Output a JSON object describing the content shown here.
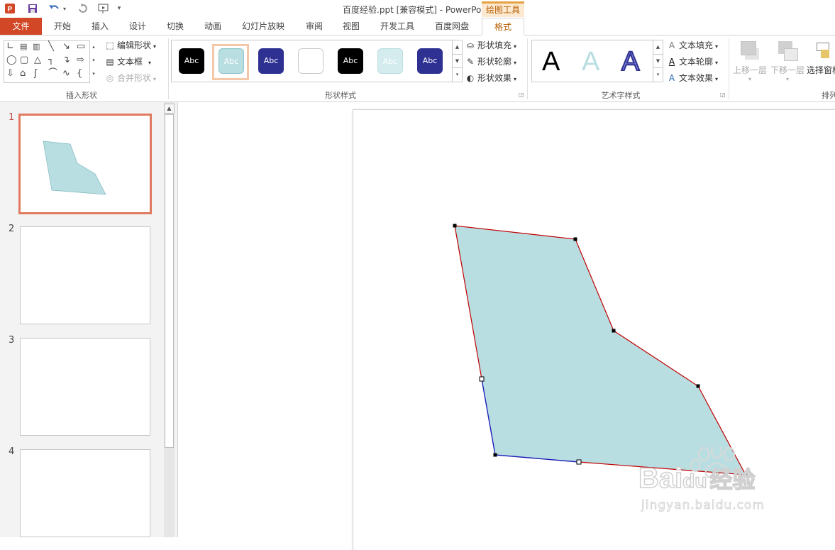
{
  "window": {
    "title": "百度经验.ppt [兼容模式] - PowerPoint",
    "contextual_tab_group": "绘图工具"
  },
  "quick_access": {
    "icons": [
      "powerpoint-logo-icon",
      "save-icon",
      "undo-icon",
      "redo-icon",
      "start-from-beginning-icon",
      "customize-qat-icon"
    ]
  },
  "tabs": [
    {
      "label": "文件"
    },
    {
      "label": "开始"
    },
    {
      "label": "插入"
    },
    {
      "label": "设计"
    },
    {
      "label": "切换"
    },
    {
      "label": "动画"
    },
    {
      "label": "幻灯片放映"
    },
    {
      "label": "审阅"
    },
    {
      "label": "视图"
    },
    {
      "label": "开发工具"
    },
    {
      "label": "百度网盘"
    },
    {
      "label": "格式"
    }
  ],
  "ribbon": {
    "insert_shapes": {
      "label": "插入形状",
      "edit_shape": "编辑形状",
      "text_box": "文本框",
      "merge_shapes": "合并形状"
    },
    "shape_styles": {
      "label": "形状样式",
      "style_text": "Abc",
      "fill": "形状填充",
      "outline": "形状轮廓",
      "effects": "形状效果"
    },
    "wordart_styles": {
      "label": "艺术字样式",
      "letter": "A",
      "text_fill": "文本填充",
      "text_outline": "文本轮廓",
      "text_effects": "文本效果"
    },
    "arrange": {
      "label": "排列",
      "bring_forward": "上移一层",
      "send_backward": "下移一层",
      "selection_pane": "选择窗格"
    }
  },
  "thumbnails": [
    {
      "number": "1"
    },
    {
      "number": "2"
    },
    {
      "number": "3"
    },
    {
      "number": "4"
    }
  ],
  "colors": {
    "file_tab": "#d24726",
    "shape_fill": "#b9dee2",
    "shape_outline": "#c00000",
    "edit_segment": "#1f1fb8",
    "accent_orange": "#b65c00"
  },
  "watermark": {
    "brand": "Bai",
    "brand_suffix": "du",
    "label": "经验",
    "url": "jingyan.baidu.com"
  }
}
